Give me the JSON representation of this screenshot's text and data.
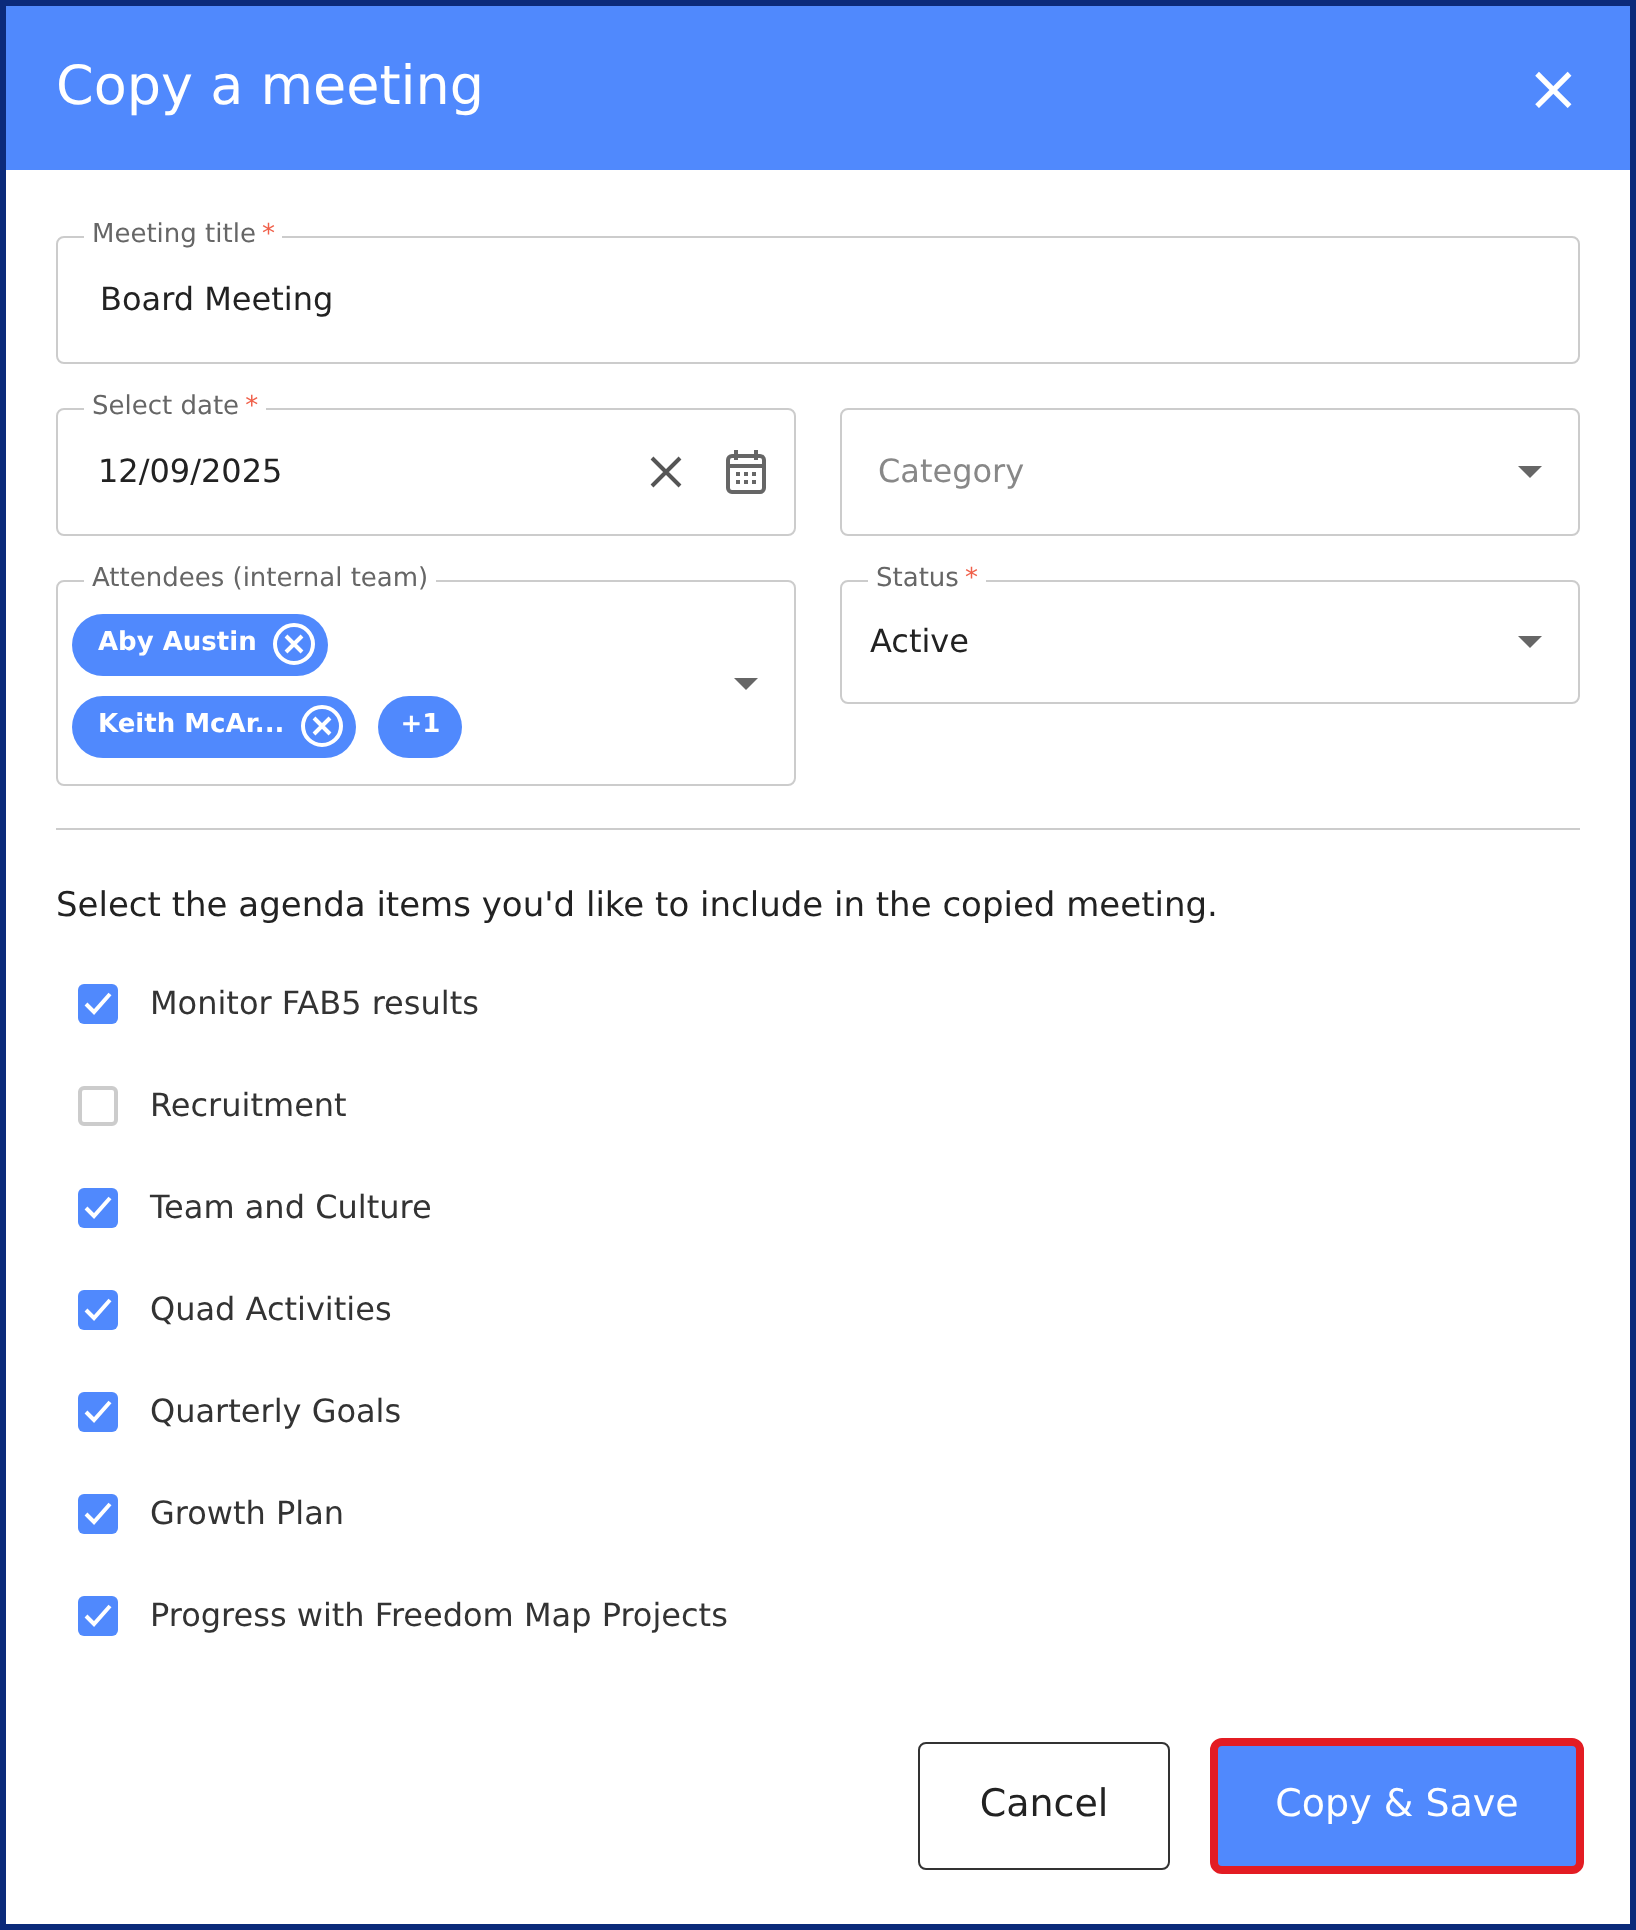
{
  "dialog": {
    "title": "Copy a meeting",
    "close_icon": "×"
  },
  "fields": {
    "title": {
      "label": "Meeting title",
      "required_mark": "*",
      "value": "Board Meeting"
    },
    "date": {
      "label": "Select date",
      "required_mark": "*",
      "value": "12/09/2025"
    },
    "category": {
      "placeholder": "Category"
    },
    "attendees": {
      "label": "Attendees (internal team)",
      "chips": [
        "Aby Austin",
        "Keith McAr..."
      ],
      "more": "+1"
    },
    "status": {
      "label": "Status",
      "required_mark": "*",
      "value": "Active"
    }
  },
  "instruction": "Select the agenda items you'd like to include in the copied meeting.",
  "agenda_items": [
    {
      "label": "Monitor FAB5 results",
      "checked": true
    },
    {
      "label": "Recruitment",
      "checked": false
    },
    {
      "label": "Team and Culture",
      "checked": true
    },
    {
      "label": "Quad Activities",
      "checked": true
    },
    {
      "label": "Quarterly Goals",
      "checked": true
    },
    {
      "label": "Growth Plan",
      "checked": true
    },
    {
      "label": "Progress with Freedom Map Projects",
      "checked": true
    }
  ],
  "buttons": [
    {
      "label": "Cancel",
      "kind": "secondary",
      "highlighted": false
    },
    {
      "label": "Copy & Save",
      "kind": "primary",
      "highlighted": true
    }
  ]
}
